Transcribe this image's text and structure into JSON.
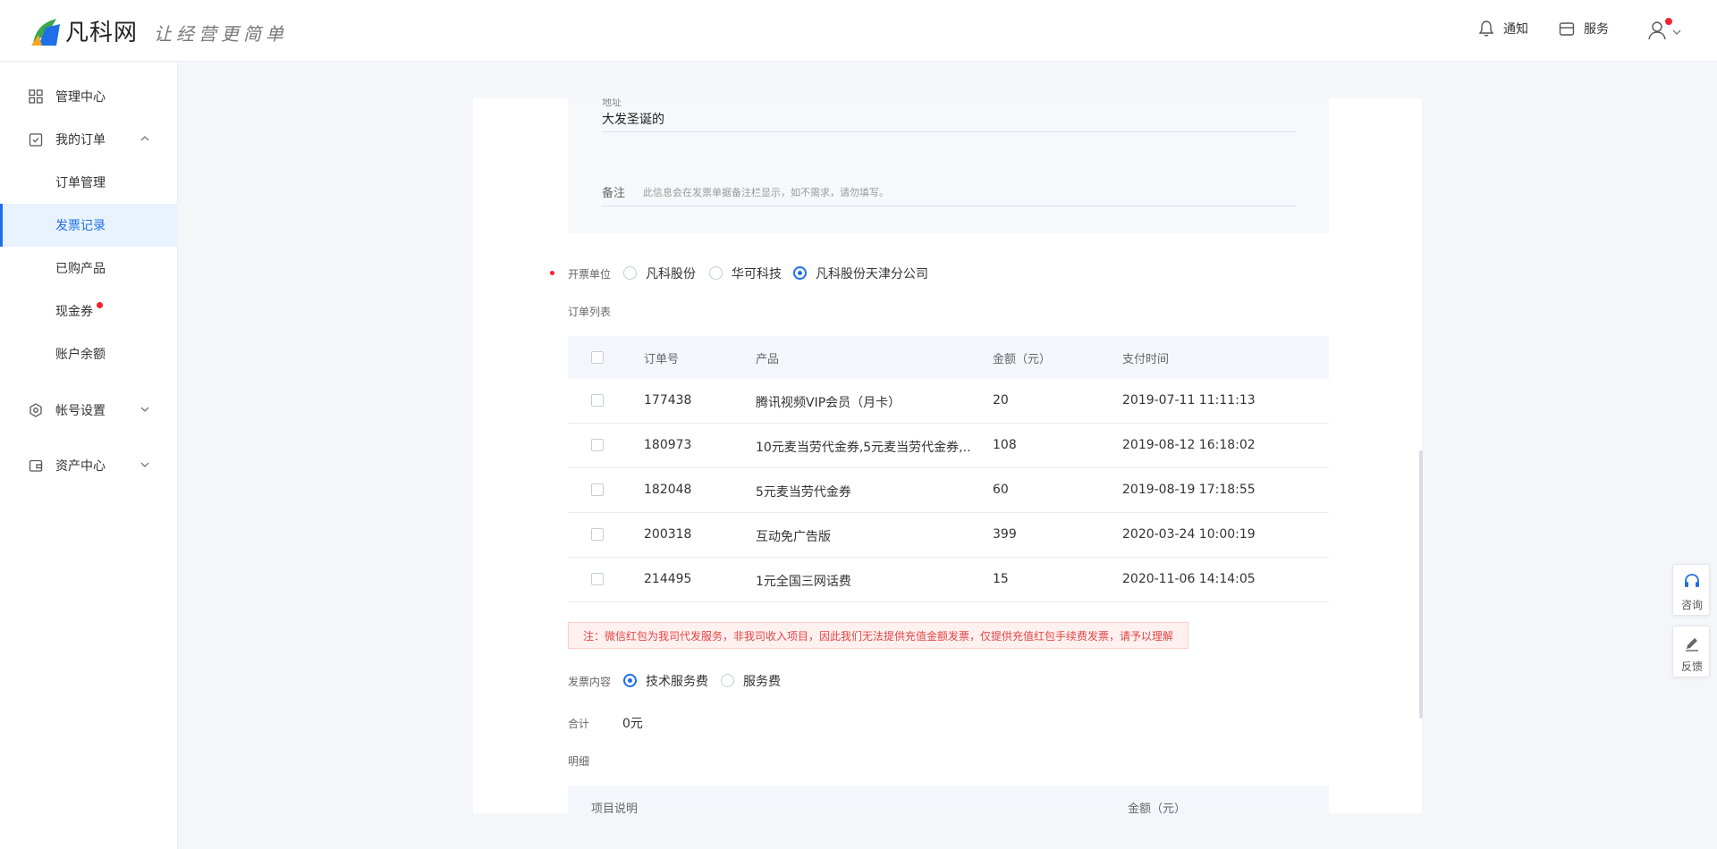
{
  "header": {
    "brand": "凡科网",
    "slogan": "让经营更简单",
    "notify_label": "通知",
    "service_label": "服务"
  },
  "sidebar": {
    "items": [
      {
        "label": "管理中心",
        "icon": "grid-icon"
      },
      {
        "label": "我的订单",
        "icon": "clipboard-check-icon",
        "expanded": true
      },
      {
        "label": "订单管理"
      },
      {
        "label": "发票记录",
        "active": true
      },
      {
        "label": "已购产品"
      },
      {
        "label": "现金券",
        "badge": true
      },
      {
        "label": "账户余额"
      },
      {
        "label": "帐号设置",
        "icon": "gear-icon"
      },
      {
        "label": "资产中心",
        "icon": "wallet-icon"
      }
    ]
  },
  "form": {
    "address_label": "地址",
    "address_value": "大发圣诞的",
    "remark_label": "备注",
    "remark_placeholder": "此信息会在发票单据备注栏显示，如不需求，请勿填写。",
    "issuer_label": "开票单位",
    "issuer_options": [
      "凡科股份",
      "华可科技",
      "凡科股份天津分公司"
    ],
    "issuer_selected": "凡科股份天津分公司",
    "order_list_label": "订单列表",
    "table_headers": [
      "订单号",
      "产品",
      "金额（元）",
      "支付时间"
    ],
    "orders": [
      {
        "id": "177438",
        "product": "腾讯视频VIP会员（月卡）",
        "amount": "20",
        "time": "2019-07-11 11:11:13"
      },
      {
        "id": "180973",
        "product": "10元麦当劳代金券,5元麦当劳代金券,...",
        "amount": "108",
        "time": "2019-08-12 16:18:02"
      },
      {
        "id": "182048",
        "product": "5元麦当劳代金券",
        "amount": "60",
        "time": "2019-08-19 17:18:55"
      },
      {
        "id": "200318",
        "product": "互动免广告版",
        "amount": "399",
        "time": "2020-03-24 10:00:19"
      },
      {
        "id": "214495",
        "product": "1元全国三网话费",
        "amount": "15",
        "time": "2020-11-06 14:14:05"
      }
    ],
    "notice": "注：微信红包为我司代发服务，非我司收入项目，因此我们无法提供充值金额发票，仅提供充值红包手续费发票，请予以理解",
    "content_label": "发票内容",
    "content_options": [
      "技术服务费",
      "服务费"
    ],
    "content_selected": "技术服务费",
    "total_label": "合计",
    "total_value": "0元",
    "detail_label": "明细",
    "detail_headers": [
      "项目说明",
      "金额（元）"
    ]
  },
  "float_buttons": {
    "consult_label": "咨询",
    "feedback_label": "反馈"
  },
  "colors": {
    "accent": "#1f6fe8",
    "danger": "#f5222d"
  }
}
